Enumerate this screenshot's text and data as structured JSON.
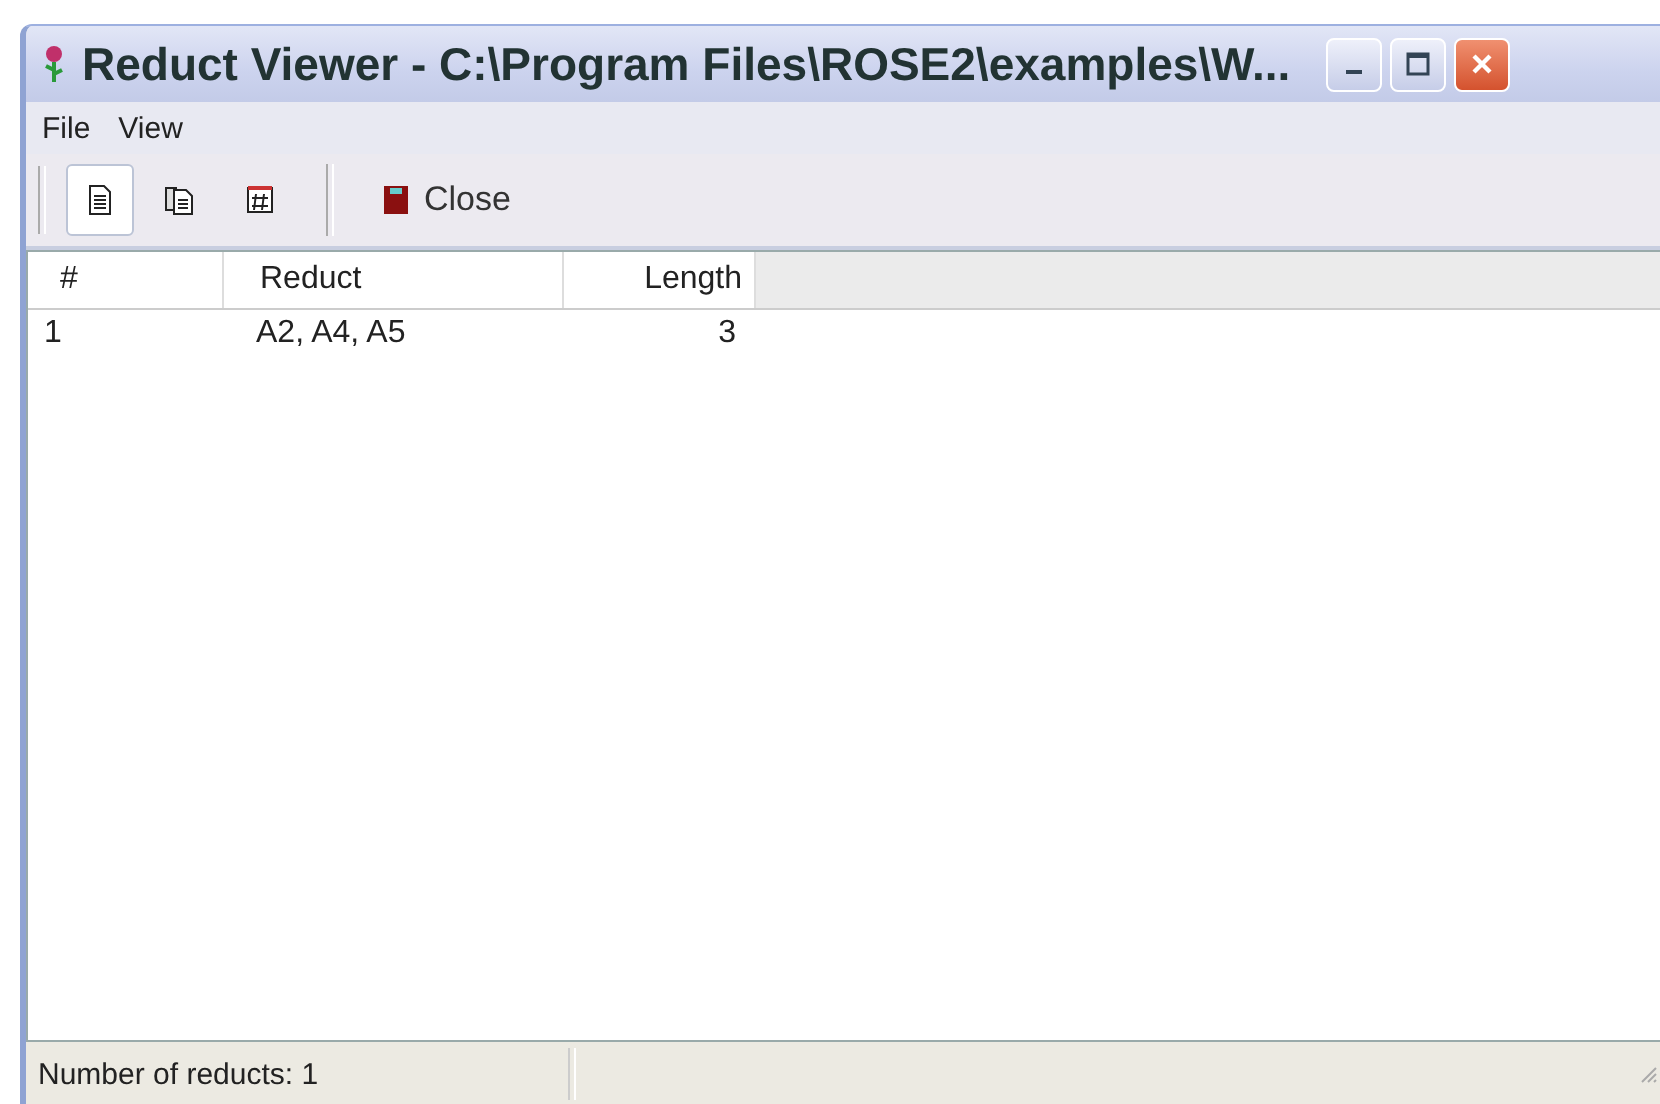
{
  "window": {
    "title": "Reduct Viewer - C:\\Program Files\\ROSE2\\examples\\W..."
  },
  "menu": [
    "File",
    "View"
  ],
  "toolbar": {
    "view_buttons": [
      {
        "selected": true
      },
      {
        "selected": false
      },
      {
        "selected": false
      }
    ],
    "close_button": "Close"
  },
  "table": {
    "columns": [
      "#",
      "Reduct",
      "Length"
    ],
    "rows": [
      [
        "1",
        "A2, A4, A5",
        "3"
      ]
    ]
  },
  "status_bar": "Number of reducts: 1"
}
